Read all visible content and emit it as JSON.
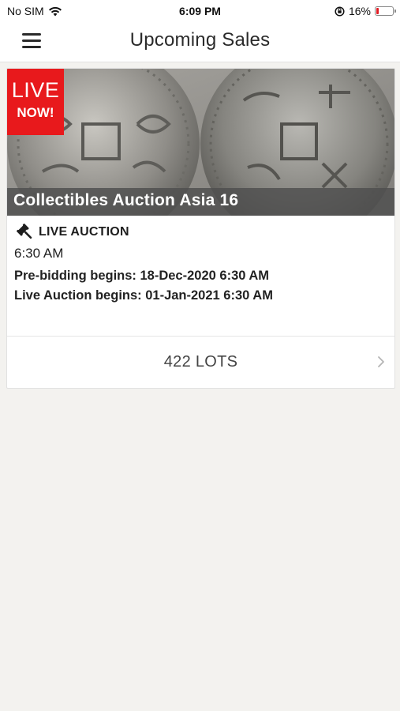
{
  "status_bar": {
    "carrier": "No SIM",
    "time": "6:09 PM",
    "battery_percent": "16%",
    "battery_level": 0.16,
    "icons": [
      "wifi-icon",
      "orientation-lock-icon",
      "battery-icon"
    ]
  },
  "nav": {
    "title": "Upcoming Sales",
    "menu_icon": "hamburger-menu-icon"
  },
  "sale": {
    "badge_line1": "LIVE",
    "badge_line2": "NOW!",
    "title": "Collectibles Auction Asia 16",
    "type_icon": "gavel-icon",
    "type_label": "LIVE AUCTION",
    "time": "6:30 AM",
    "prebid": "Pre-bidding begins: 18-Dec-2020 6:30 AM",
    "live_begins": "Live Auction begins: 01-Jan-2021 6:30 AM",
    "lots": "422 LOTS"
  },
  "colors": {
    "badge": "#e8191c",
    "background": "#f3f2ef",
    "battery_low": "#e21c24"
  }
}
